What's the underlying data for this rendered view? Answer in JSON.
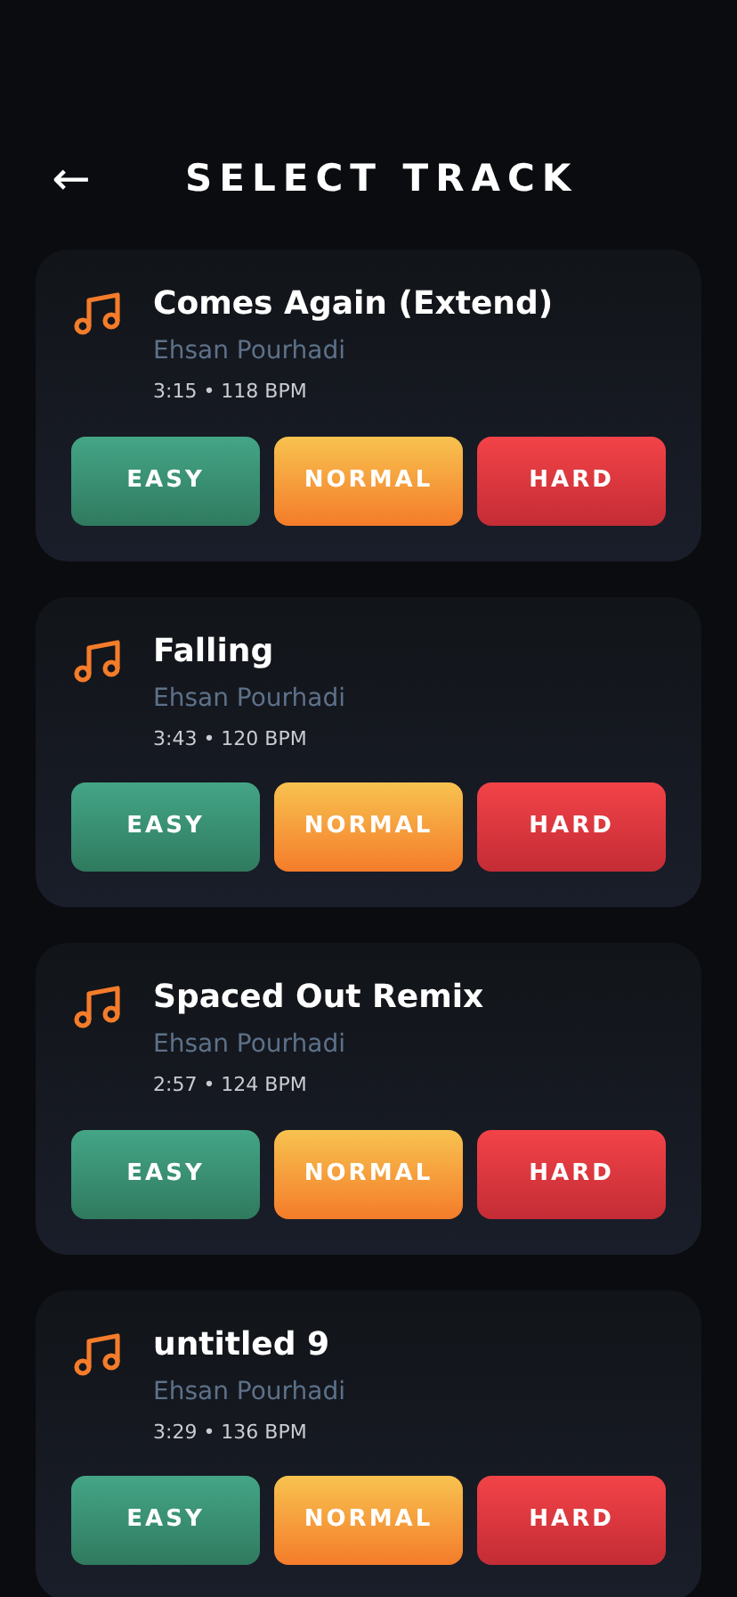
{
  "header": {
    "back": "←",
    "title": "SELECT TRACK"
  },
  "tracks": [
    {
      "title": "Comes Again (Extend)",
      "artist": "Ehsan Pourhadi",
      "meta": "3:15 • 118 BPM",
      "buttons": [
        {
          "label": "EASY",
          "kind": "easy"
        },
        {
          "label": "NORMAL",
          "kind": "normal"
        },
        {
          "label": "HARD",
          "kind": "hard"
        }
      ]
    },
    {
      "title": "Falling",
      "artist": "Ehsan Pourhadi",
      "meta": "3:43 • 120 BPM",
      "buttons": [
        {
          "label": "EASY",
          "kind": "easy"
        },
        {
          "label": "NORMAL",
          "kind": "normal"
        },
        {
          "label": "HARD",
          "kind": "hard"
        }
      ]
    },
    {
      "title": "Spaced Out Remix",
      "artist": "Ehsan Pourhadi",
      "meta": "2:57 • 124 BPM",
      "buttons": [
        {
          "label": "EASY",
          "kind": "easy"
        },
        {
          "label": "NORMAL",
          "kind": "normal"
        },
        {
          "label": "HARD",
          "kind": "hard"
        }
      ]
    },
    {
      "title": "untitled 9",
      "artist": "Ehsan Pourhadi",
      "meta": "3:29 • 136 BPM",
      "buttons": [
        {
          "label": "EASY",
          "kind": "easy"
        },
        {
          "label": "NORMAL",
          "kind": "normal"
        },
        {
          "label": "HARD",
          "kind": "hard"
        }
      ]
    }
  ]
}
